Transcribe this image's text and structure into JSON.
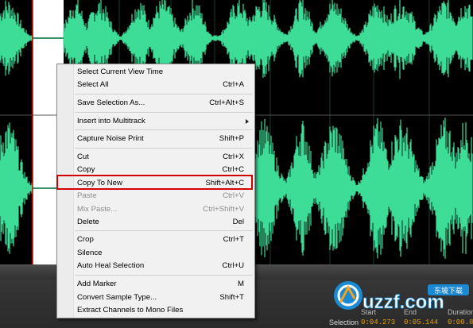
{
  "colors": {
    "wave": "#3ddc97",
    "selection_line": "#d40000",
    "highlight": "#d00000",
    "timecode": "#e8a000"
  },
  "context_menu": {
    "items": [
      {
        "label": "Select Current View Time",
        "shortcut": ""
      },
      {
        "label": "Select All",
        "shortcut": "Ctrl+A"
      },
      {
        "label": "Save Selection As...",
        "shortcut": "Ctrl+Alt+S"
      },
      {
        "label": "Insert into Multitrack",
        "shortcut": ""
      },
      {
        "label": "Capture Noise Print",
        "shortcut": "Shift+P"
      },
      {
        "label": "Cut",
        "shortcut": "Ctrl+X"
      },
      {
        "label": "Copy",
        "shortcut": "Ctrl+C"
      },
      {
        "label": "Copy To New",
        "shortcut": "Shift+Alt+C"
      },
      {
        "label": "Paste",
        "shortcut": "Ctrl+V"
      },
      {
        "label": "Mix Paste...",
        "shortcut": "Ctrl+Shift+V"
      },
      {
        "label": "Delete",
        "shortcut": "Del"
      },
      {
        "label": "Crop",
        "shortcut": "Ctrl+T"
      },
      {
        "label": "Silence",
        "shortcut": ""
      },
      {
        "label": "Auto Heal Selection",
        "shortcut": "Ctrl+U"
      },
      {
        "label": "Add Marker",
        "shortcut": "M"
      },
      {
        "label": "Convert Sample Type...",
        "shortcut": "Shift+T"
      },
      {
        "label": "Extract Channels to Mono Files",
        "shortcut": ""
      }
    ]
  },
  "selection_panel": {
    "row_label": "Selection",
    "headers": [
      "Start",
      "End",
      "Duration"
    ],
    "values": [
      "0:04.273",
      "0:05.144",
      "0:00.871"
    ]
  },
  "watermark": {
    "brand": "uzzf.com",
    "tag": "东坡下载"
  }
}
